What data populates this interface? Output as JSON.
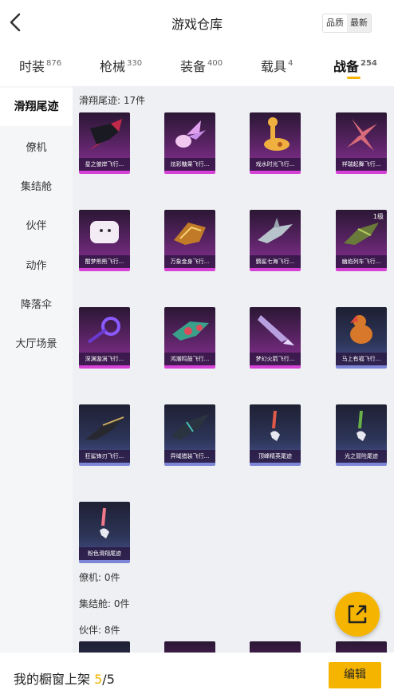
{
  "header": {
    "title": "游戏仓库",
    "sort": [
      "品质",
      "最新"
    ]
  },
  "tabs": [
    {
      "label": "时装",
      "count": "876"
    },
    {
      "label": "枪械",
      "count": "330"
    },
    {
      "label": "装备",
      "count": "400"
    },
    {
      "label": "载具",
      "count": "4"
    },
    {
      "label": "战备",
      "count": "254"
    }
  ],
  "sidebar": [
    {
      "label": "滑翔尾迹"
    },
    {
      "label": "僚机"
    },
    {
      "label": "集结舱"
    },
    {
      "label": "伙伴"
    },
    {
      "label": "动作"
    },
    {
      "label": "降落伞"
    },
    {
      "label": "大厅场景"
    }
  ],
  "sections": {
    "glide_title": "滑翔尾迹: 17件",
    "wingman_title": "僚机: 0件",
    "capsule_title": "集结舱: 0件",
    "partner_title": "伙伴: 8件"
  },
  "items": [
    {
      "label": "星之彼岸飞行...",
      "rarity": "purple",
      "icon": "dark-jet-icon"
    },
    {
      "label": "炫彩糖果飞行...",
      "rarity": "purple",
      "icon": "candy-icon"
    },
    {
      "label": "戏水时光飞行...",
      "rarity": "purple",
      "icon": "giraffe-float-icon"
    },
    {
      "label": "祥瑞起舞飞行...",
      "rarity": "purple",
      "icon": "ribbon-star-icon"
    },
    {
      "label": "酣梦熊熊飞行...",
      "rarity": "purple",
      "icon": "bear-pillow-icon"
    },
    {
      "label": "万象金身飞行...",
      "rarity": "purple",
      "icon": "golden-craft-icon"
    },
    {
      "label": "鹦鲨七海飞行...",
      "rarity": "purple",
      "icon": "shark-craft-icon"
    },
    {
      "label": "幽焰列车飞行...",
      "rarity": "purple",
      "icon": "green-train-icon",
      "level": "1级"
    },
    {
      "label": "深渊漩涡飞行...",
      "rarity": "purple",
      "icon": "vortex-icon"
    },
    {
      "label": "鸿潮鸣鼓飞行...",
      "rarity": "purple",
      "icon": "drum-craft-icon"
    },
    {
      "label": "梦幻火箭飞行...",
      "rarity": "purple",
      "icon": "rocket-icon"
    },
    {
      "label": "马上有福飞行...",
      "rarity": "blue",
      "icon": "horse-icon"
    },
    {
      "label": "狂鲨锋刃飞行...",
      "rarity": "blue",
      "icon": "blade-shark-icon"
    },
    {
      "label": "异域猎装飞行...",
      "rarity": "blue",
      "icon": "hunter-craft-icon"
    },
    {
      "label": "顶峰精英尾迹",
      "rarity": "blue",
      "icon": "red-trail-icon"
    },
    {
      "label": "光之冒险尾迹",
      "rarity": "blue",
      "icon": "green-trail-icon"
    },
    {
      "label": "粉色滑翔尾迹",
      "rarity": "blue",
      "icon": "pink-trail-icon"
    }
  ],
  "footer": {
    "text": "我的橱窗上架",
    "current": "5",
    "total": "/5",
    "edit_label": "编辑"
  },
  "colors": {
    "accent": "#f5b400",
    "purple_rarity": "#d642d6",
    "blue_rarity": "#7d86d6"
  }
}
